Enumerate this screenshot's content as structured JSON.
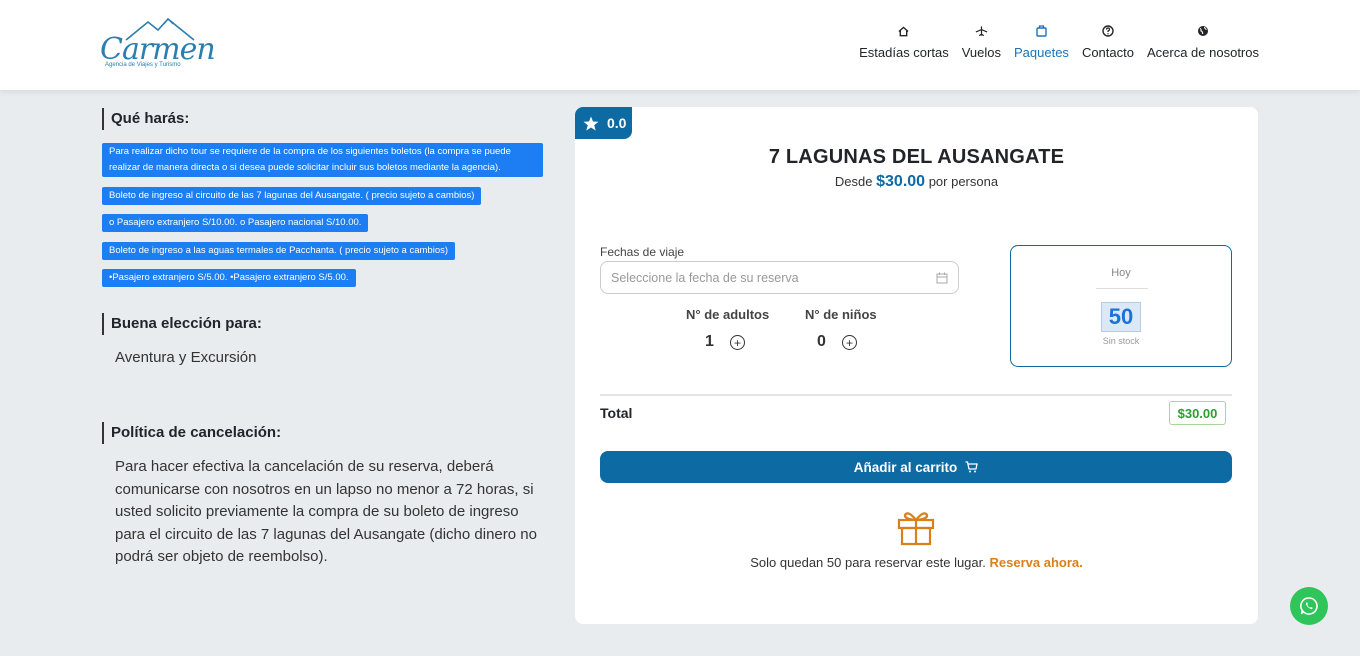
{
  "brand": {
    "name": "Carmen",
    "tagline": "Agencia de Viajes y Turismo"
  },
  "nav": [
    {
      "label": "Estadías cortas",
      "icon": "home-icon"
    },
    {
      "label": "Vuelos",
      "icon": "plane-icon"
    },
    {
      "label": "Paquetes",
      "icon": "suitcase-icon",
      "active": true
    },
    {
      "label": "Contacto",
      "icon": "question-icon"
    },
    {
      "label": "Acerca de nosotros",
      "icon": "globe-icon"
    }
  ],
  "left": {
    "what_title": "Qué harás:",
    "what_items": [
      "Para realizar dicho tour se requiere  de la compra de los siguientes boletos (la compra se puede realizar de manera directa o si desea puede solicitar  incluir sus boletos mediante la agencia).",
      "Boleto de ingreso al circuito de las 7 lagunas del Ausangate. ( precio sujeto a cambios)",
      "o  Pasajero extranjero S/10.00. o   Pasajero nacional S/10.00.",
      "Boleto de ingreso a las aguas termales de Pacchanta. ( precio sujeto a cambios)",
      "•Pasajero extranjero S/5.00. •Pasajero extranjero S/5.00."
    ],
    "good_title": "Buena elección para:",
    "good_text": "Aventura y Excursión",
    "policy_title": "Política de cancelación:",
    "policy_text": "Para hacer efectiva la cancelación de su reserva, deberá comunicarse con nosotros en un lapso no menor a 72 horas, si usted solicito previamente la compra de su boleto de ingreso para el circuito de las 7 lagunas del Ausangate (dicho dinero no podrá ser objeto de reembolso)."
  },
  "card": {
    "rating": "0.0",
    "title": "7 LAGUNAS DEL AUSANGATE",
    "price_prefix": "Desde",
    "price": "$30.00",
    "price_suffix": "por persona",
    "date_label": "Fechas de viaje",
    "date_placeholder": "Seleccione la fecha de su reserva",
    "adults_label": "N° de adultos",
    "adults_value": "1",
    "children_label": "N° de niños",
    "children_value": "0",
    "availability": {
      "day": "Hoy",
      "count": "50",
      "status": "Sin stock"
    },
    "total_label": "Total",
    "total_value": "$30.00",
    "cart_button": "Añadir al carrito",
    "stock_message": "Solo quedan 50 para reservar este lugar.",
    "stock_cta": "Reserva ahora."
  },
  "colors": {
    "primary": "#0d6aa3",
    "badge": "#1c7ef2",
    "success": "#27a12f",
    "accent": "#d9801a",
    "whatsapp": "#2fc55b"
  }
}
